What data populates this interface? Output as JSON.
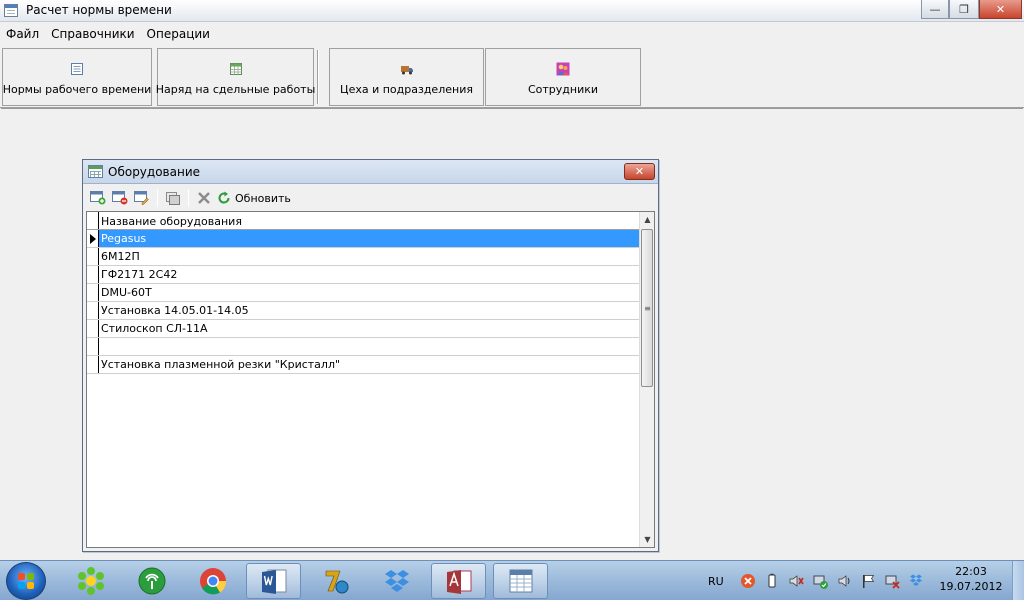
{
  "window": {
    "title": "Расчет нормы времени"
  },
  "menu": [
    "Файл",
    "Справочники",
    "Операции"
  ],
  "toolbar": [
    {
      "label": "Нормы рабочего времени",
      "icon": "document-list-icon"
    },
    {
      "label": "Наряд на сдельные работы",
      "icon": "table-icon"
    },
    {
      "label": "Цеха и подразделения",
      "icon": "truck-icon"
    },
    {
      "label": "Сотрудники",
      "icon": "people-icon"
    }
  ],
  "child": {
    "title": "Оборудование",
    "toolbar": {
      "refresh_label": "Обновить"
    },
    "grid": {
      "column": "Название оборудования",
      "rows": [
        "Pegasus",
        "6М12П",
        "ГФ2171 2С42",
        "DMU-60T",
        "Установка 14.05.01-14.05",
        "Стилоскоп СЛ-11А",
        "",
        "Установка плазменной резки \"Кристалл\""
      ],
      "selected_index": 0
    }
  },
  "taskbar": {
    "apps": [
      "icq-icon",
      "network-icon",
      "chrome-icon",
      "word-icon",
      "7zip-icon",
      "dropbox-icon",
      "access-icon",
      "table-app-icon"
    ],
    "language": "RU",
    "time": "22:03",
    "date": "19.07.2012"
  }
}
